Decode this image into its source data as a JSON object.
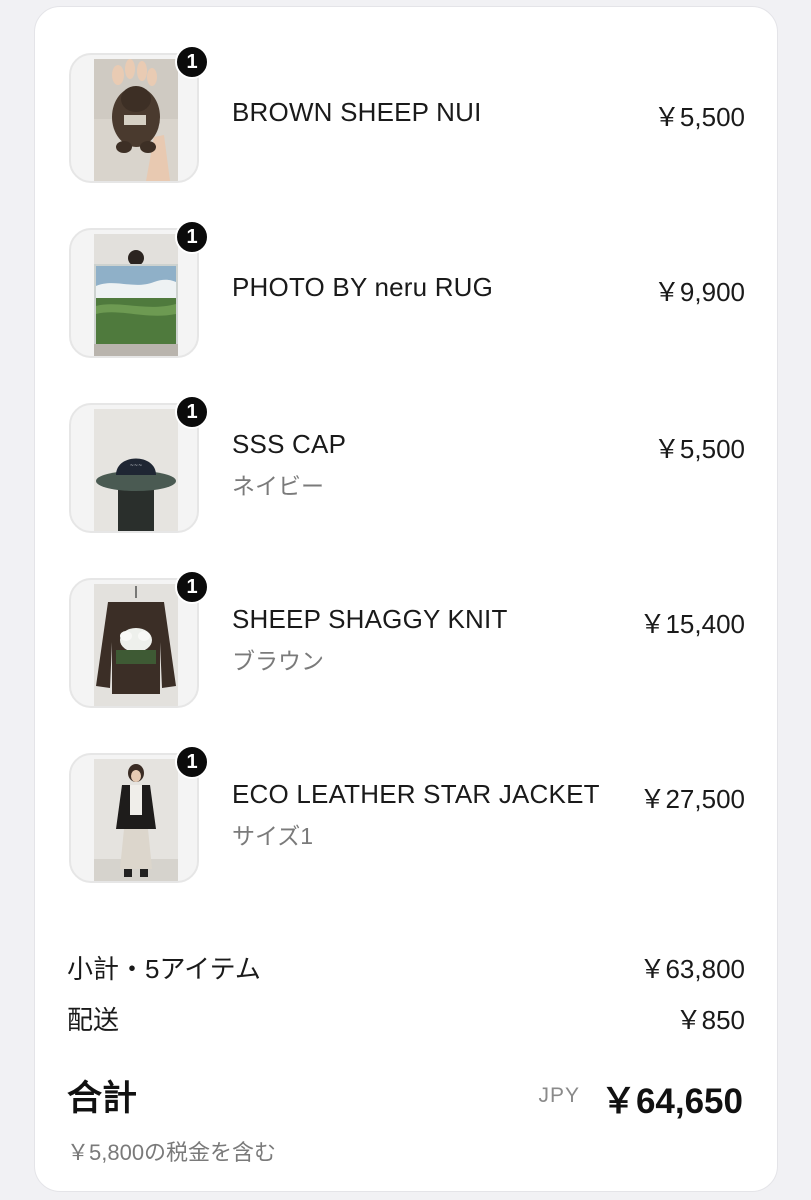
{
  "items": [
    {
      "name": "BROWN SHEEP NUI",
      "variant": "",
      "price": "￥5,500",
      "quantity": "1",
      "thumbnail_icon": "sheep-plush-photo"
    },
    {
      "name": "PHOTO BY neru RUG",
      "variant": "",
      "price": "￥9,900",
      "quantity": "1",
      "thumbnail_icon": "landscape-rug-photo"
    },
    {
      "name": "SSS CAP",
      "variant": "ネイビー",
      "price": "￥5,500",
      "quantity": "1",
      "thumbnail_icon": "navy-cap-photo"
    },
    {
      "name": "SHEEP SHAGGY KNIT",
      "variant": "ブラウン",
      "price": "￥15,400",
      "quantity": "1",
      "thumbnail_icon": "brown-knit-photo"
    },
    {
      "name": "ECO LEATHER STAR JACKET",
      "variant": "サイズ1",
      "price": "￥27,500",
      "quantity": "1",
      "thumbnail_icon": "leather-jacket-photo"
    }
  ],
  "summary": {
    "subtotal_label": "小計・5アイテム",
    "subtotal_value": "￥63,800",
    "shipping_label": "配送",
    "shipping_value": "￥850",
    "total_label": "合計",
    "currency": "JPY",
    "total_value": "￥64,650",
    "tax_note": "￥5,800の税金を含む"
  },
  "colors": {
    "badge": "#0b0b0b",
    "text_primary": "#1a1a1a",
    "text_secondary": "#7a7a7a",
    "page_background": "#f1f1f4"
  }
}
